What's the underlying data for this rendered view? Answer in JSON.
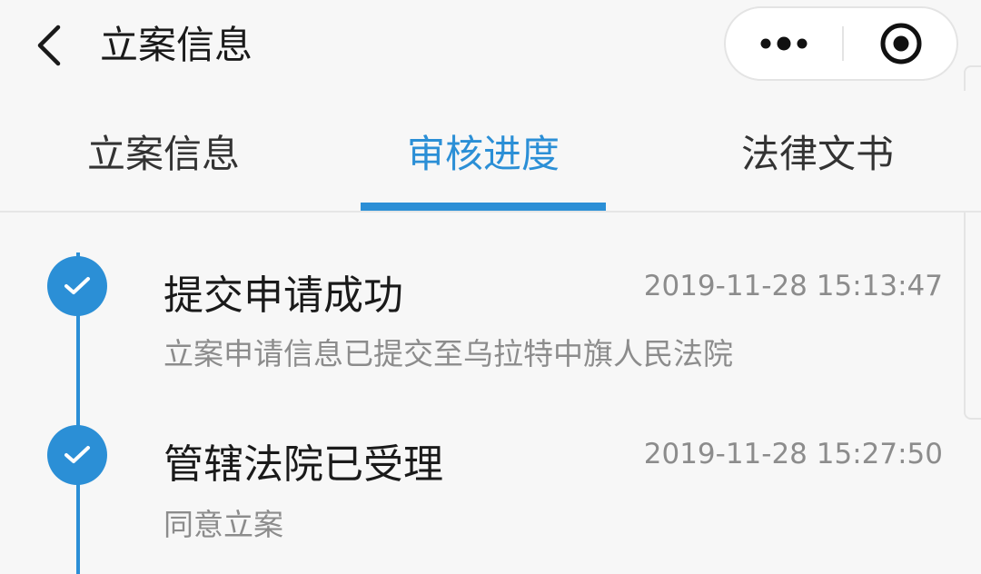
{
  "nav": {
    "title": "立案信息",
    "back_icon": "chevron-left-icon",
    "more_icon": "more-dots-icon",
    "close_icon": "record-target-icon"
  },
  "tabs": [
    {
      "label": "立案信息",
      "active": false
    },
    {
      "label": "审核进度",
      "active": true
    },
    {
      "label": "法律文书",
      "active": false
    }
  ],
  "colors": {
    "accent": "#2b8fd6",
    "background": "#f7f7f7",
    "title_text": "#1a1a1a",
    "secondary_text": "#8c8c8c"
  },
  "steps": [
    {
      "title": "提交申请成功",
      "description": "立案申请信息已提交至乌拉特中旗人民法院",
      "time": "2019-11-28 15:13:47",
      "status_icon": "check-circle-icon"
    },
    {
      "title": "管辖法院已受理",
      "description": "同意立案",
      "time": "2019-11-28 15:27:50",
      "status_icon": "check-circle-icon"
    }
  ]
}
